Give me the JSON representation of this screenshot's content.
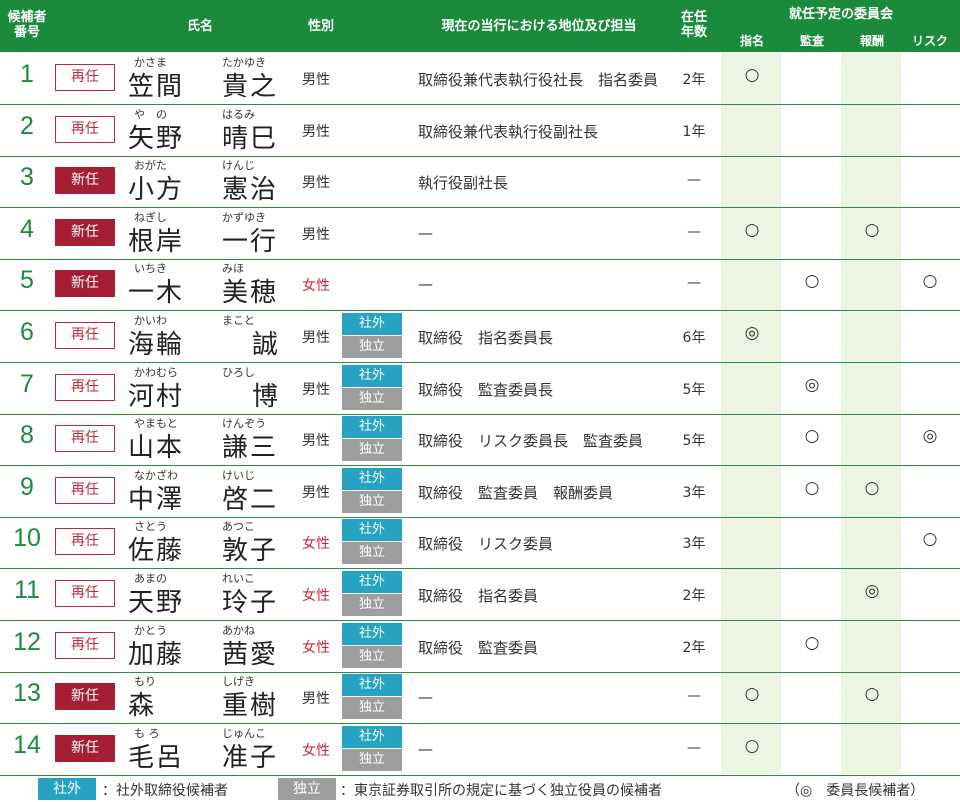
{
  "header": {
    "candidate_no": "候補者番号",
    "name": "氏名",
    "gender": "性別",
    "position": "現在の当行における地位及び担当",
    "tenure": "在任年数",
    "committees_title": "就任予定の委員会",
    "committees": [
      "指名",
      "監査",
      "報酬",
      "リスク"
    ]
  },
  "colors": {
    "header_green": "#1b8a3c",
    "shade": "#ebf5e2",
    "reappoint_red": "#c0283a",
    "new_fill": "#a51e34",
    "outside_blue": "#26a3c2",
    "independent_gray": "#9d9d9d",
    "female_red": "#d0283a"
  },
  "rows": [
    {
      "no": "1",
      "status": "再任",
      "status_type": "re",
      "ruby_family": "かさま",
      "ruby_given": "たかゆき",
      "family": "笠間",
      "given": "貴之",
      "gender": "男性",
      "gender_type": "m",
      "outside": "",
      "independent": "",
      "position": "取締役兼代表執行役社長　指名委員",
      "tenure": "2年",
      "marks": [
        "○",
        "",
        "",
        ""
      ]
    },
    {
      "no": "2",
      "status": "再任",
      "status_type": "re",
      "ruby_family": "や　の",
      "ruby_given": "はるみ",
      "family": "矢野",
      "given": "晴巳",
      "gender": "男性",
      "gender_type": "m",
      "outside": "",
      "independent": "",
      "position": "取締役兼代表執行役副社長",
      "tenure": "1年",
      "marks": [
        "",
        "",
        "",
        ""
      ]
    },
    {
      "no": "3",
      "status": "新任",
      "status_type": "shin",
      "ruby_family": "おがた",
      "ruby_given": "けんじ",
      "family": "小方",
      "given": "憲治",
      "gender": "男性",
      "gender_type": "m",
      "outside": "",
      "independent": "",
      "position": "執行役副社長",
      "tenure": "—",
      "marks": [
        "",
        "",
        "",
        ""
      ]
    },
    {
      "no": "4",
      "status": "新任",
      "status_type": "shin",
      "ruby_family": "ねぎし",
      "ruby_given": "かずゆき",
      "family": "根岸",
      "given": "一行",
      "gender": "男性",
      "gender_type": "m",
      "outside": "",
      "independent": "",
      "position": "—",
      "tenure": "—",
      "marks": [
        "○",
        "",
        "○",
        ""
      ]
    },
    {
      "no": "5",
      "status": "新任",
      "status_type": "shin",
      "ruby_family": "いちき",
      "ruby_given": "みほ",
      "family": "一木",
      "given": "美穂",
      "gender": "女性",
      "gender_type": "f",
      "outside": "",
      "independent": "",
      "position": "—",
      "tenure": "—",
      "marks": [
        "",
        "○",
        "",
        "○"
      ]
    },
    {
      "no": "6",
      "status": "再任",
      "status_type": "re",
      "ruby_family": "かいわ",
      "ruby_given": "まこと",
      "family": "海輪",
      "given": "誠",
      "gender": "男性",
      "gender_type": "m",
      "outside": "社外",
      "independent": "独立",
      "position": "取締役　指名委員長",
      "tenure": "6年",
      "marks": [
        "◎",
        "",
        "",
        ""
      ]
    },
    {
      "no": "7",
      "status": "再任",
      "status_type": "re",
      "ruby_family": "かわむら",
      "ruby_given": "ひろし",
      "family": "河村",
      "given": "博",
      "gender": "男性",
      "gender_type": "m",
      "outside": "社外",
      "independent": "独立",
      "position": "取締役　監査委員長",
      "tenure": "5年",
      "marks": [
        "",
        "◎",
        "",
        ""
      ]
    },
    {
      "no": "8",
      "status": "再任",
      "status_type": "re",
      "ruby_family": "やまもと",
      "ruby_given": "けんぞう",
      "family": "山本",
      "given": "謙三",
      "gender": "男性",
      "gender_type": "m",
      "outside": "社外",
      "independent": "独立",
      "position": "取締役　リスク委員長　監査委員",
      "tenure": "5年",
      "marks": [
        "",
        "○",
        "",
        "◎"
      ]
    },
    {
      "no": "9",
      "status": "再任",
      "status_type": "re",
      "ruby_family": "なかざわ",
      "ruby_given": "けいじ",
      "family": "中澤",
      "given": "啓二",
      "gender": "男性",
      "gender_type": "m",
      "outside": "社外",
      "independent": "独立",
      "position": "取締役　監査委員　報酬委員",
      "tenure": "3年",
      "marks": [
        "",
        "○",
        "○",
        ""
      ]
    },
    {
      "no": "10",
      "status": "再任",
      "status_type": "re",
      "ruby_family": "さとう",
      "ruby_given": "あつこ",
      "family": "佐藤",
      "given": "敦子",
      "gender": "女性",
      "gender_type": "f",
      "outside": "社外",
      "independent": "独立",
      "position": "取締役　リスク委員",
      "tenure": "3年",
      "marks": [
        "",
        "",
        "",
        "○"
      ]
    },
    {
      "no": "11",
      "status": "再任",
      "status_type": "re",
      "ruby_family": "あまの",
      "ruby_given": "れいこ",
      "family": "天野",
      "given": "玲子",
      "gender": "女性",
      "gender_type": "f",
      "outside": "社外",
      "independent": "独立",
      "position": "取締役　指名委員",
      "tenure": "2年",
      "marks": [
        "",
        "",
        "◎",
        ""
      ]
    },
    {
      "no": "12",
      "status": "再任",
      "status_type": "re",
      "ruby_family": "かとう",
      "ruby_given": "あかね",
      "family": "加藤",
      "given": "茜愛",
      "gender": "女性",
      "gender_type": "f",
      "outside": "社外",
      "independent": "独立",
      "position": "取締役　監査委員",
      "tenure": "2年",
      "marks": [
        "",
        "○",
        "",
        ""
      ]
    },
    {
      "no": "13",
      "status": "新任",
      "status_type": "shin",
      "ruby_family": "もり",
      "ruby_given": "しげき",
      "family": "森",
      "given": "重樹",
      "gender": "男性",
      "gender_type": "m",
      "outside": "社外",
      "independent": "独立",
      "position": "—",
      "tenure": "—",
      "marks": [
        "○",
        "",
        "○",
        ""
      ]
    },
    {
      "no": "14",
      "status": "新任",
      "status_type": "shin",
      "ruby_family": "も ろ",
      "ruby_given": "じゅんこ",
      "family": "毛呂",
      "given": "准子",
      "gender": "女性",
      "gender_type": "f",
      "outside": "社外",
      "independent": "独立",
      "position": "—",
      "tenure": "—",
      "marks": [
        "○",
        "",
        "",
        ""
      ]
    }
  ],
  "footer": {
    "outside_tag": "社外",
    "outside_desc": "：社外取締役候補者",
    "independent_tag": "独立",
    "independent_desc": "：東京証券取引所の規定に基づく独立役員の候補者",
    "legend": "（◎　委員長候補者）"
  }
}
